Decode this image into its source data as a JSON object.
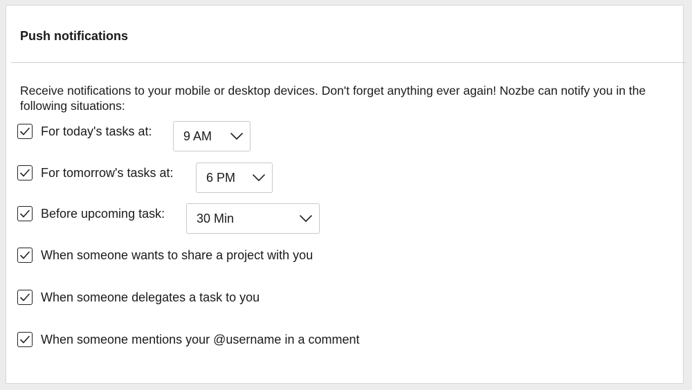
{
  "section": {
    "title": "Push notifications",
    "description": "Receive notifications to your mobile or desktop devices. Don't forget anything ever again! Nozbe can notify you in the following situations:"
  },
  "options": [
    {
      "label": "For today's tasks at:",
      "checked": true,
      "select_value": "9 AM"
    },
    {
      "label": "For tomorrow's tasks at:",
      "checked": true,
      "select_value": "6 PM"
    },
    {
      "label": "Before upcoming task:",
      "checked": true,
      "select_value": "30 Min"
    },
    {
      "label": "When someone wants to share a project with you",
      "checked": true
    },
    {
      "label": "When someone delegates a task to you",
      "checked": true
    },
    {
      "label": "When someone mentions your @username in a comment",
      "checked": true
    }
  ],
  "icons": {
    "checkbox_check": "checkmark-icon",
    "select_arrow": "chevron-down-icon"
  }
}
